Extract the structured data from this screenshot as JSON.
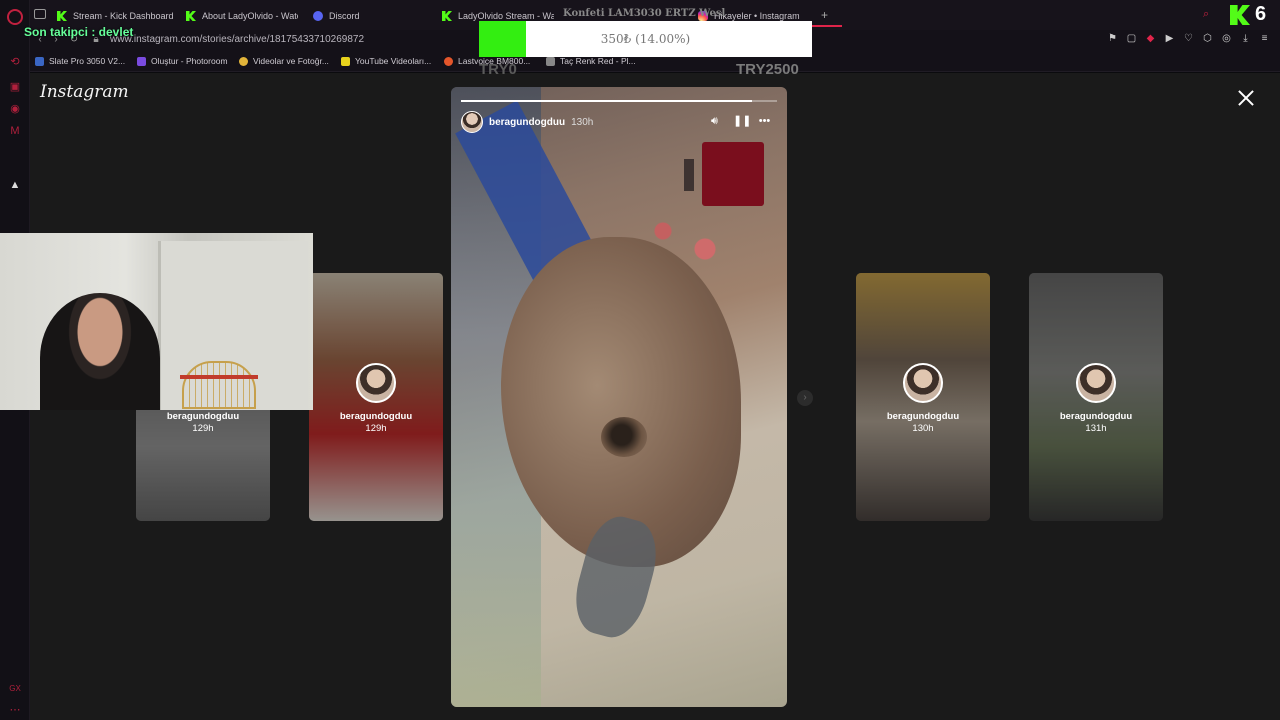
{
  "tabs": [
    {
      "label": "Stream - Kick Dashboard",
      "icon": "kick"
    },
    {
      "label": "About LadyOlvido - Watc",
      "icon": "kick"
    },
    {
      "label": "Discord",
      "icon": "discord"
    },
    {
      "label": "LadyOlvido Stream - Wat",
      "icon": "kick"
    },
    {
      "label": "Hikayeler • Instagram",
      "icon": "instagram"
    }
  ],
  "address": {
    "url": "www.instagram.com/stories/archive/18175433710269872"
  },
  "bookmarks": [
    {
      "label": "Slate Pro 3050 V2..."
    },
    {
      "label": "Oluştur - Photoroom"
    },
    {
      "label": "Videolar ve Fotoğr..."
    },
    {
      "label": "YouTube Videoları..."
    },
    {
      "label": "Lastvoice BM800..."
    },
    {
      "label": "Taç Renk Red - Pl..."
    }
  ],
  "instagram": {
    "logo": "Instagram",
    "main_story": {
      "username": "beragundogduu",
      "time": "130h",
      "progress": 0.92
    },
    "cards": [
      {
        "username": "beragundogduu",
        "time": "129h"
      },
      {
        "username": "beragundogduu",
        "time": "129h"
      },
      {
        "username": "beragundogduu",
        "time": "130h"
      },
      {
        "username": "beragundogduu",
        "time": "131h"
      }
    ]
  },
  "overlay": {
    "last_follower": "Son takipci : devlet",
    "ticker": "Konfeti LAM3030 ERTZ Wesl",
    "goal": {
      "text": "350₺ (14.00%)",
      "percent": 14,
      "min_label": "TRY0",
      "max_label": "TRY2500"
    },
    "kick_count": "6"
  },
  "colors": {
    "accent": "#e0244a",
    "kick": "#53fc18",
    "goal_fill": "#33ee11"
  }
}
